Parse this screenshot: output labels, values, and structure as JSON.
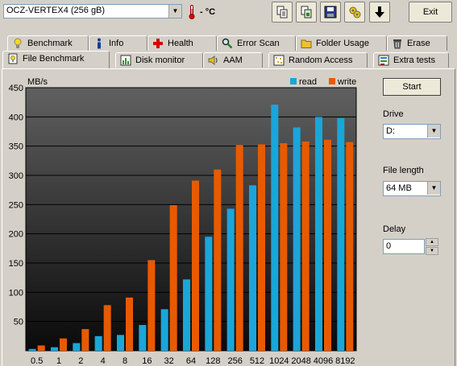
{
  "toolbar": {
    "drive": "OCZ-VERTEX4 (256 gB)",
    "temperature": "- °C",
    "exit_label": "Exit",
    "icons": [
      "copy-text-icon",
      "copy-image-icon",
      "save-icon",
      "options-icon",
      "down-arrow-icon"
    ]
  },
  "tabs_top": [
    {
      "label": "Benchmark",
      "icon": "benchmark-bulb-icon"
    },
    {
      "label": "Info",
      "icon": "info-icon"
    },
    {
      "label": "Health",
      "icon": "health-cross-icon"
    },
    {
      "label": "Error Scan",
      "icon": "magnifier-icon"
    },
    {
      "label": "Folder Usage",
      "icon": "folder-icon"
    },
    {
      "label": "Erase",
      "icon": "trash-icon"
    }
  ],
  "tabs_bottom": [
    {
      "label": "File Benchmark",
      "icon": "file-benchmark-icon",
      "active": true
    },
    {
      "label": "Disk monitor",
      "icon": "disk-monitor-icon"
    },
    {
      "label": "AAM",
      "icon": "speaker-icon"
    },
    {
      "label": "Random Access",
      "icon": "random-access-icon"
    },
    {
      "label": "Extra tests",
      "icon": "extra-tests-icon"
    }
  ],
  "side": {
    "start_label": "Start",
    "drive_label": "Drive",
    "drive_value": "D:",
    "file_length_label": "File length",
    "file_length_value": "64 MB",
    "delay_label": "Delay",
    "delay_value": "0"
  },
  "colors": {
    "read": "#1aa6d8",
    "write": "#e85a00",
    "plot_top": "#606060",
    "plot_bottom": "#0a0a0a"
  },
  "chart_data": {
    "type": "bar",
    "ylabel": "MB/s",
    "ylim": [
      0,
      450
    ],
    "yticks": [
      50,
      100,
      150,
      200,
      250,
      300,
      350,
      400,
      450
    ],
    "grid": true,
    "legend": "top-right",
    "categories": [
      "0.5",
      "1",
      "2",
      "4",
      "8",
      "16",
      "32",
      "64",
      "128",
      "256",
      "512",
      "1024",
      "2048",
      "4096",
      "8192"
    ],
    "series": [
      {
        "name": "read",
        "values": [
          3,
          6,
          13,
          25,
          27,
          44,
          71,
          122,
          195,
          243,
          283,
          421,
          382,
          400,
          398
        ]
      },
      {
        "name": "write",
        "values": [
          9,
          21,
          37,
          78,
          91,
          155,
          249,
          291,
          310,
          352,
          353,
          355,
          358,
          361,
          357
        ]
      }
    ]
  }
}
